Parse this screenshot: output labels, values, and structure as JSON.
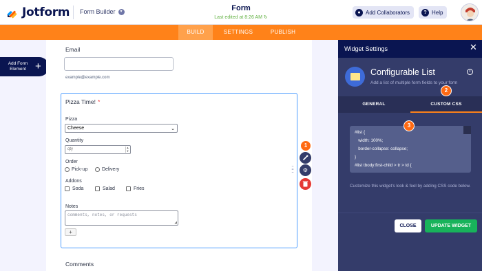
{
  "header": {
    "logo_text": "Jotform",
    "form_builder_label": "Form Builder",
    "form_title": "Form",
    "last_edited": "Last edited at 8:26 AM",
    "collab_label": "Add Collaborators",
    "help_label": "Help"
  },
  "tabs": {
    "build": "BUILD",
    "settings": "SETTINGS",
    "publish": "PUBLISH"
  },
  "left": {
    "add_element_line1": "Add Form",
    "add_element_line2": "Element"
  },
  "form": {
    "email_label": "Email",
    "email_placeholder": "",
    "email_sublabel": "example@example.com",
    "widget_title": "Pizza Time!",
    "required_mark": "*",
    "pizza_label": "Pizza",
    "pizza_value": "Cheese",
    "quantity_label": "Quantity",
    "quantity_value": "qty",
    "order_label": "Order",
    "order_options": [
      "Pick-up",
      "Delivery"
    ],
    "addons_label": "Addons",
    "addons_options": [
      "Soda",
      "Salad",
      "Fries"
    ],
    "notes_label": "Notes",
    "notes_placeholder": "comments, notes, or requests",
    "add_row": "+",
    "comments_label": "Comments"
  },
  "badges": {
    "b1": "1",
    "b2": "2",
    "b3": "3"
  },
  "panel": {
    "title": "Widget Settings",
    "widget_name": "Configurable List",
    "widget_desc": "Add a list of multiple form fields to your form",
    "tab_general": "GENERAL",
    "tab_css": "CUSTOM CSS",
    "css_lines": [
      "#list {",
      "   width: 100%;",
      "   border-collapse: collapse;",
      "}",
      "#list tbody:first-child > tr > td {"
    ],
    "css_hint": "Customize this widget's look & feel by adding CSS code below.",
    "close_label": "CLOSE",
    "update_label": "UPDATE WIDGET"
  },
  "colors": {
    "brand_orange": "#ff8219",
    "navy": "#0a1551",
    "panel_bg": "#343c6a",
    "update_green": "#18b35b",
    "focus_blue": "#4c9cff"
  }
}
